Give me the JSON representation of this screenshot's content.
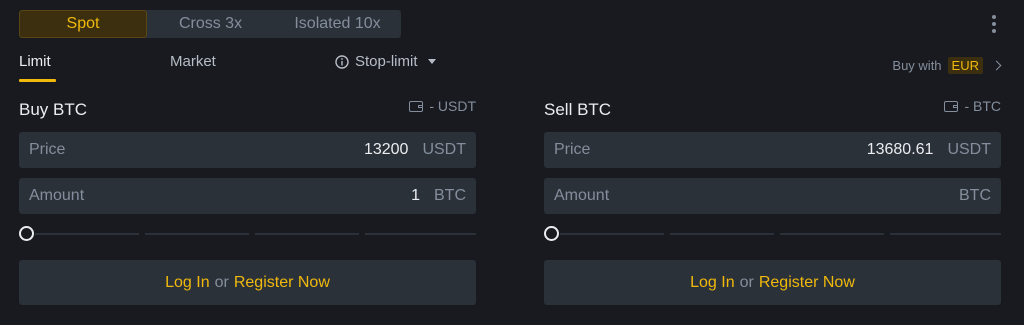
{
  "mode_tabs": [
    "Spot",
    "Cross 3x",
    "Isolated 10x"
  ],
  "order_types": {
    "limit": "Limit",
    "market": "Market",
    "stop_limit": "Stop-limit"
  },
  "buy_with": {
    "label": "Buy with",
    "currency": "EUR"
  },
  "buy": {
    "title": "Buy BTC",
    "balance": "- USDT",
    "price": {
      "label": "Price",
      "value": "13200",
      "unit": "USDT"
    },
    "amount": {
      "label": "Amount",
      "value": "1",
      "unit": "BTC"
    }
  },
  "sell": {
    "title": "Sell BTC",
    "balance": "- BTC",
    "price": {
      "label": "Price",
      "value": "13680.61",
      "unit": "USDT"
    },
    "amount": {
      "label": "Amount",
      "value": "",
      "unit": "BTC"
    }
  },
  "auth": {
    "login": "Log In",
    "or": "or",
    "register": "Register Now"
  },
  "colors": {
    "accent": "#f0b90b",
    "background": "#181a20",
    "field": "#2b3139",
    "muted": "#848e9c"
  }
}
